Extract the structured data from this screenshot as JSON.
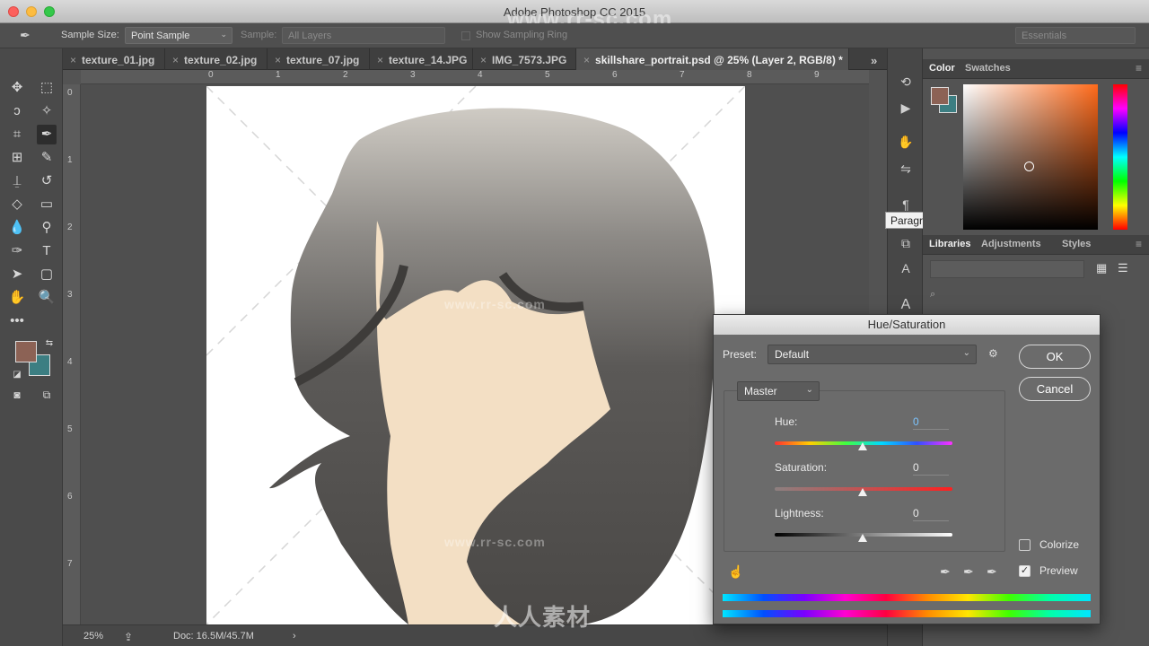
{
  "app": {
    "title": "Adobe Photoshop CC 2015",
    "watermark": "www.rr-sc.com"
  },
  "options_bar": {
    "sample_size_label": "Sample Size:",
    "sample_size_value": "Point Sample",
    "sample_label": "Sample:",
    "sample_value": "All Layers",
    "show_ring_label": "Show Sampling Ring",
    "workspace": "Essentials"
  },
  "tabs": [
    {
      "label": "texture_01.jpg"
    },
    {
      "label": "texture_02.jpg"
    },
    {
      "label": "texture_07.jpg"
    },
    {
      "label": "texture_14.JPG"
    },
    {
      "label": "IMG_7573.JPG"
    },
    {
      "label": "skillshare_portrait.psd @ 25% (Layer 2, RGB/8) *"
    }
  ],
  "ruler_h": [
    "0",
    "1",
    "2",
    "3",
    "4",
    "5",
    "6",
    "7",
    "8",
    "9"
  ],
  "ruler_v": [
    "0",
    "1",
    "2",
    "3",
    "4",
    "5",
    "6",
    "7"
  ],
  "status": {
    "zoom": "25%",
    "doc": "Doc: 16.5M/45.7M"
  },
  "tooltip": "Paragraph",
  "panels": {
    "color_tabs": [
      "Color",
      "Swatches"
    ],
    "library_tabs": [
      "Libraries",
      "Adjustments",
      "Styles"
    ],
    "foreground": "#8c6255",
    "background": "#3c7e82"
  },
  "dialog": {
    "title": "Hue/Saturation",
    "preset_label": "Preset:",
    "preset_value": "Default",
    "channel": "Master",
    "ok": "OK",
    "cancel": "Cancel",
    "hue_label": "Hue:",
    "hue_value": "0",
    "sat_label": "Saturation:",
    "sat_value": "0",
    "light_label": "Lightness:",
    "light_value": "0",
    "colorize": "Colorize",
    "preview": "Preview",
    "preview_checked": true,
    "colorize_checked": false
  },
  "footer_watermark": "人人素材"
}
